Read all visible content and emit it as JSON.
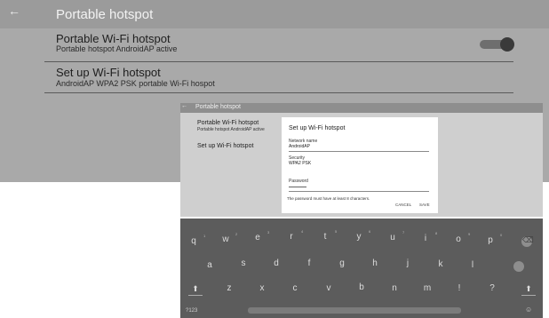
{
  "background_screen": {
    "back_icon": "←",
    "title": "Portable hotspot",
    "row1": {
      "title": "Portable Wi-Fi hotspot",
      "subtitle": "Portable hotspot AndroidAP active",
      "toggle_on": true
    },
    "row2": {
      "title": "Set up Wi-Fi hotspot",
      "subtitle": "AndroidAP WPA2 PSK portable Wi-Fi hospot"
    }
  },
  "inner_screen": {
    "back_icon": "←",
    "title": "Portable hotspot",
    "row1": {
      "title": "Portable Wi-Fi hotspot",
      "subtitle": "Portable hotspot AndroidAP active"
    },
    "row2": {
      "title": "Set up Wi-Fi hotspot"
    },
    "dialog": {
      "title": "Set up Wi-Fi hotspot",
      "network_name_label": "Network name",
      "network_name_value": "AndroidAP",
      "security_label": "Security",
      "security_value": "WPA2 PSK",
      "password_label": "Password",
      "hint": "The password must have at least 8 characters.",
      "cancel": "CANCEL",
      "save": "SAVE"
    }
  },
  "keyboard": {
    "row1": [
      "q",
      "w",
      "e",
      "r",
      "t",
      "y",
      "u",
      "i",
      "o",
      "p"
    ],
    "row1_hints": [
      "1",
      "2",
      "3",
      "4",
      "5",
      "6",
      "7",
      "8",
      "9",
      "0"
    ],
    "row2": [
      "a",
      "s",
      "d",
      "f",
      "g",
      "h",
      "j",
      "k",
      "l"
    ],
    "row3": [
      "z",
      "x",
      "c",
      "v",
      "b",
      "n",
      "m",
      "!",
      "?"
    ],
    "shift_icon": "⬆",
    "backspace_icon": "⌫",
    "sym_key": "?123",
    "emoji_icon": "☺"
  },
  "colors": {
    "background": "#a9a9a9",
    "header": "#9b9b9b",
    "keyboard": "#5c5c5c"
  }
}
